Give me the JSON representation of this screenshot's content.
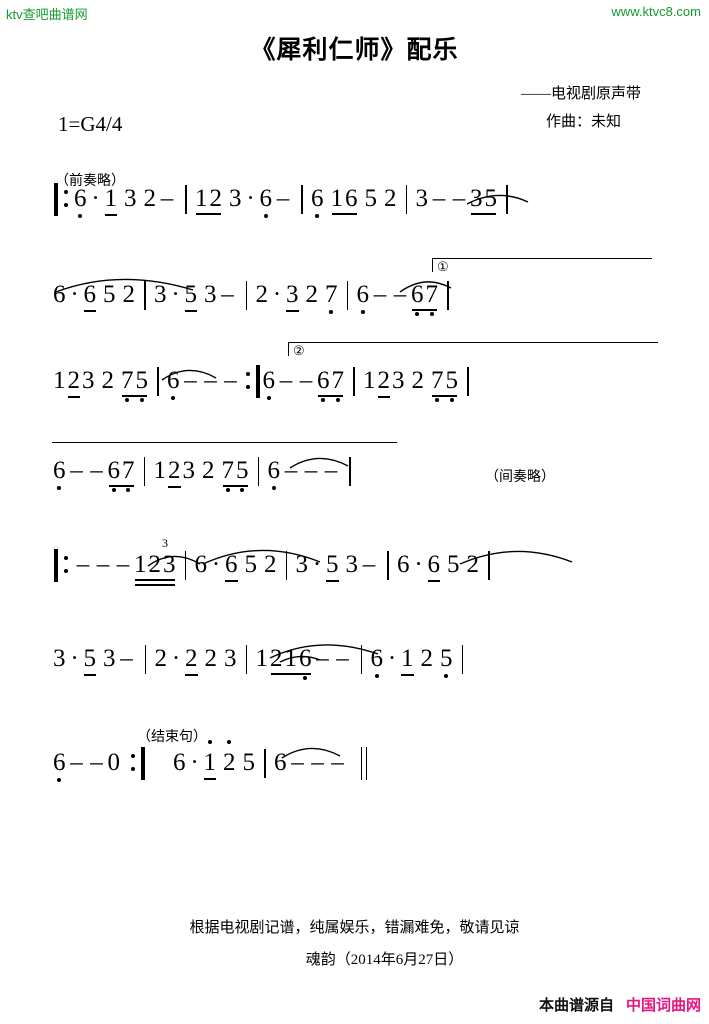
{
  "branding": {
    "watermark_left": "ktv查吧曲谱网",
    "watermark_right": "www.ktvc8.com",
    "footer_prefix": "本曲谱源自",
    "footer_site": "中国词曲网",
    "accent_color": "#e6157f",
    "watermark_color": "#149b30"
  },
  "header": {
    "title": "《犀利仁师》配乐",
    "subtitle": "——电视剧原声带",
    "composer": "作曲：未知",
    "key_signature": "1=G4/4"
  },
  "annotations": {
    "prelude_omitted": "（前奏略）",
    "interlude_omitted": "（间奏略）",
    "ending_phrase": "（结束句）",
    "volta_1": "①",
    "volta_2": "②",
    "triplet": "3"
  },
  "footer": {
    "note": "根据电视剧记谱，纯属娱乐，错漏难免，敬请见谅",
    "signature": "魂韵（2014年6月27日）"
  },
  "chart_data": {
    "type": "table",
    "title": "《犀利仁师》配乐 — 简谱 (jianpu numbered notation)",
    "key": "1=G",
    "time_signature": "4/4",
    "notation_legend": {
      "number": "scale degree 1-7, 0 = rest",
      "dot_below": "low octave",
      "dot_above": "high octave",
      "underline": "eighth note (one beam)",
      "double_underline": "sixteenth note (two beams)",
      "dash": "duration extension (one extra beat)",
      "middot": "augmentation dot (adds half value)",
      "arc": "slur / tie",
      "3_over_group": "triplet"
    },
    "lines": [
      {
        "index": 1,
        "label": "（前奏略）",
        "measures": [
          "6̣ · 1̲ 3 2 -",
          "1̲2̲ 3 · 6̣ -",
          "6̣ 1̲6̲ 5 2",
          "3 - - 3̲5̲"
        ]
      },
      {
        "index": 2,
        "measures": [
          "6 · 6̲ 5 2",
          "3 · 5̲ 3 -",
          "2 · 3̲ 2 7̣",
          "6̣ - - 6̣̲7̣̲   (①)"
        ]
      },
      {
        "index": 3,
        "measures": [
          "1 2̲ 3 2 7̣̲ 5̣̲",
          "6̣ - - -  :|",
          "6̣ - - 6̣̲7̣̲   (②)",
          "1 2̲ 3 2 7̣̲ 5̣̲"
        ]
      },
      {
        "index": 4,
        "label": "（间奏略）",
        "measures": [
          "6̣ - - 6̣̲7̣̲",
          "1 2̲ 3 2 7̣̲ 5̣̲",
          "6̣ - - -"
        ]
      },
      {
        "index": 5,
        "measures": [
          "|: - - - 1̲̲2̲̲3̲̲ (3)",
          "6 · 6̲ 5 2",
          "3 · 5̲ 3 -",
          "6 · 6̲ 5 2"
        ]
      },
      {
        "index": 6,
        "measures": [
          "3 · 5̲ 3 -",
          "2 · 2̲ 2 3",
          "1 2̲ 1 6̲̣ - -",
          "6̣ · 1̲ 2 5"
        ]
      },
      {
        "index": 7,
        "label": "（结束句）",
        "measures": [
          "6̣ - - 0 :|",
          "6 · 1̲̇ 2̇ 5",
          "6 - - -  ‖"
        ]
      }
    ]
  }
}
